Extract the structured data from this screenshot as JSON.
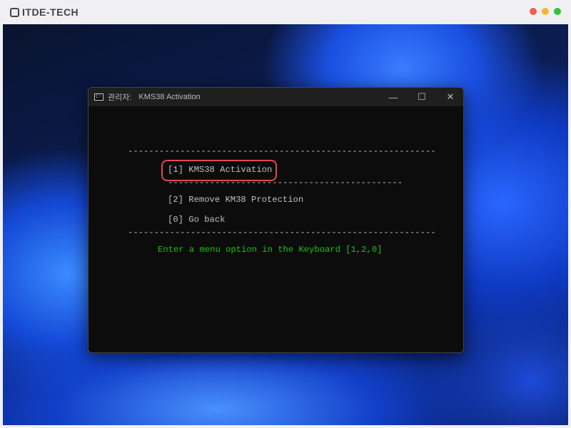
{
  "brand": {
    "name": "ITDE-TECH"
  },
  "window_dots": {
    "colors": [
      "#f25a55",
      "#f5b731",
      "#2fc244"
    ]
  },
  "terminal": {
    "title_prefix": "관리자:",
    "title": "KMS38 Activation",
    "icon_text": "C:\\",
    "controls": {
      "minimize": "—",
      "maximize": "☐",
      "close": "✕"
    },
    "separator_long": "-----------------------------------------------------------",
    "separator_short": "---------------------------------------------",
    "options": [
      {
        "label": "[1] KMS38 Activation",
        "highlighted": true
      },
      {
        "label": "[2] Remove KM38 Protection"
      },
      {
        "label": "[0] Go back"
      }
    ],
    "prompt": "Enter a menu option in the Keyboard [1,2,0]",
    "highlight_color": "#e5484d",
    "prompt_color": "#16c60c"
  }
}
